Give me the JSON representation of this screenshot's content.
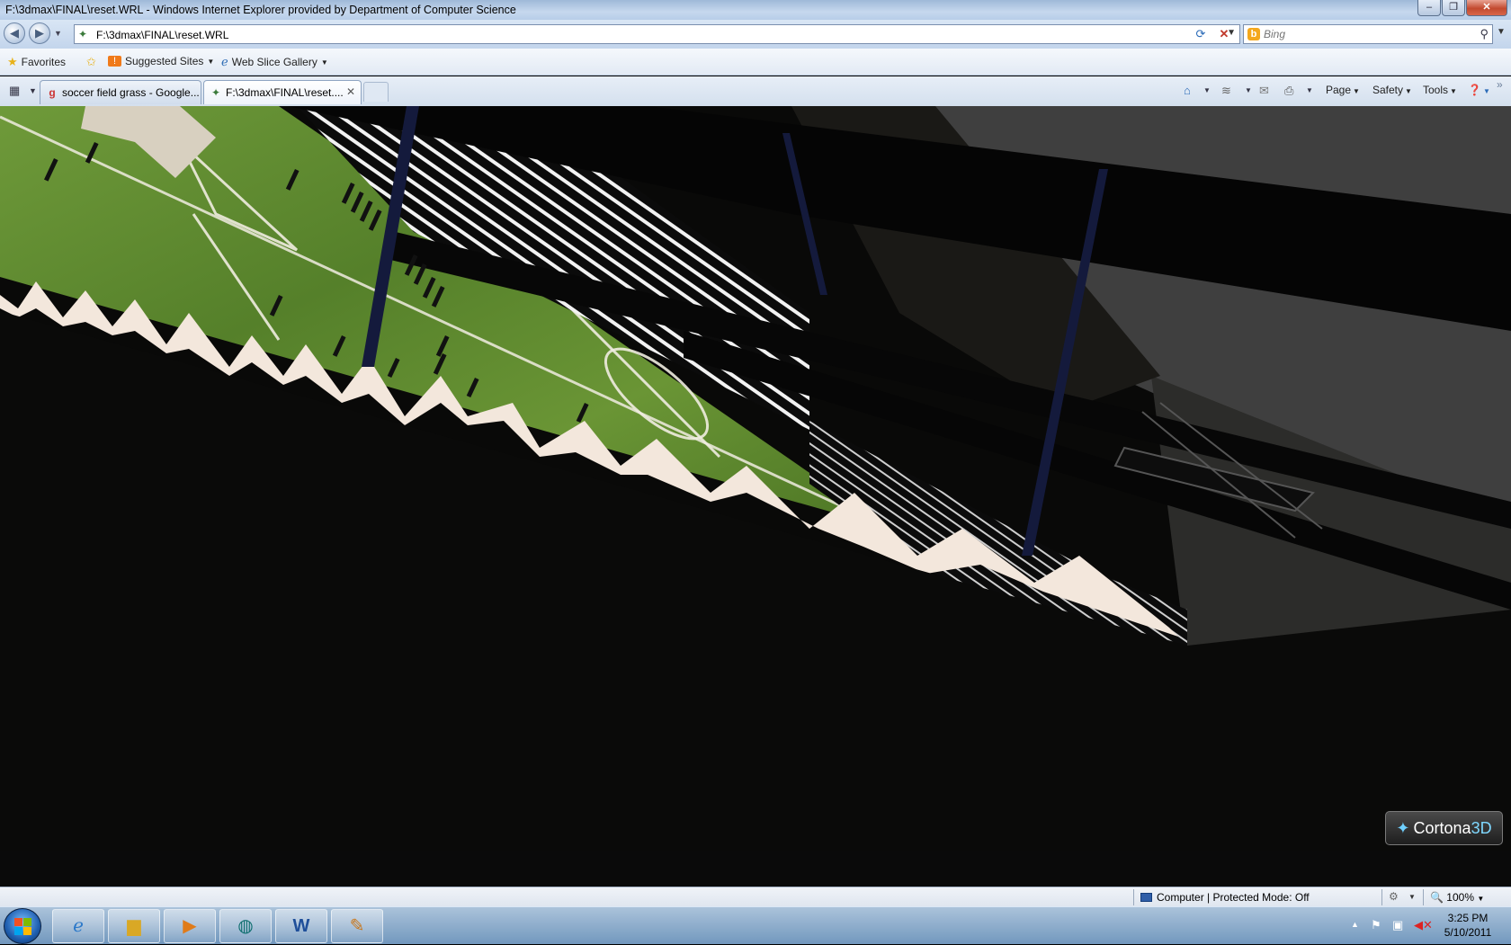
{
  "window": {
    "title": "F:\\3dmax\\FINAL\\reset.WRL - Windows Internet Explorer provided by Department of Computer Science"
  },
  "address_bar": {
    "url": "F:\\3dmax\\FINAL\\reset.WRL"
  },
  "search": {
    "placeholder": "Bing"
  },
  "favorites_bar": {
    "favorites_label": "Favorites",
    "suggested_sites_label": "Suggested Sites",
    "web_slice_gallery_label": "Web Slice Gallery"
  },
  "tabs": [
    {
      "label": "soccer field grass - Google...",
      "active": false
    },
    {
      "label": "F:\\3dmax\\FINAL\\reset....",
      "active": true
    }
  ],
  "command_bar": {
    "page_label": "Page",
    "safety_label": "Safety",
    "tools_label": "Tools"
  },
  "viewer": {
    "brand": "Cortona",
    "brand_accent": "3D",
    "toolbar_icons": [
      "walk-icon",
      "fly-icon",
      "study-icon",
      "slide-vertical-icon",
      "pan-icon",
      "tilt-icon",
      "rotate-icon",
      "fit-icon",
      "align-icon",
      "previous-viewpoint-icon",
      "next-viewpoint-icon",
      "restore-icon",
      "fullscreen-icon"
    ]
  },
  "status_bar": {
    "zone_text": "Computer | Protected Mode: Off",
    "zoom_text": "100%"
  },
  "taskbar": {
    "time": "3:25 PM",
    "date": "5/10/2011"
  },
  "colors": {
    "grass": "#5f8a2f",
    "grass_dark": "#3f6a1f",
    "pitch_lines": "#e8e3d4",
    "stand_gray": "#444444",
    "post_blue": "#12183a",
    "cortona_accent": "#7fd8ff"
  }
}
